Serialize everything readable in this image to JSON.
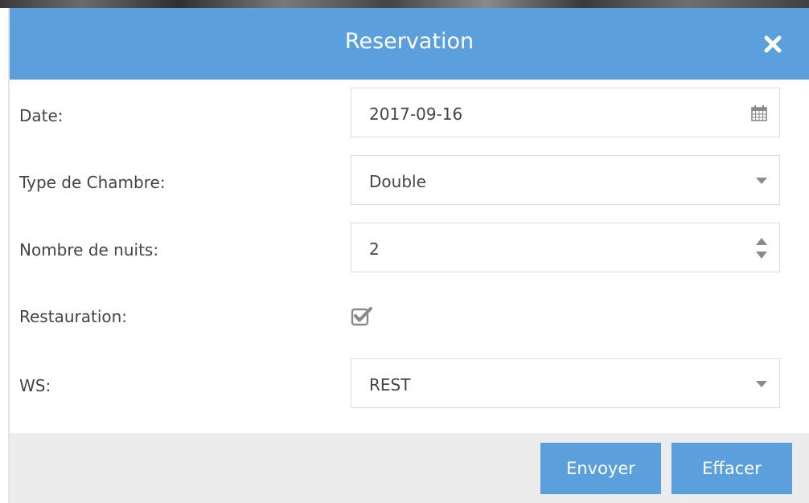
{
  "dialog": {
    "title": "Reservation"
  },
  "form": {
    "date": {
      "label": "Date:",
      "value": "2017-09-16"
    },
    "room_type": {
      "label": "Type de Chambre:",
      "value": "Double"
    },
    "nights": {
      "label": "Nombre de nuits:",
      "value": "2"
    },
    "catering": {
      "label": "Restauration:",
      "checked": true
    },
    "ws": {
      "label": "WS:",
      "value": "REST"
    }
  },
  "footer": {
    "submit_label": "Envoyer",
    "clear_label": "Effacer"
  },
  "colors": {
    "accent": "#5ba0dd",
    "footer_bg": "#ececec",
    "border": "#dcdcdc",
    "text": "#444444"
  },
  "icons": {
    "close": "close-icon",
    "date": "calendar-icon",
    "room_type": "chevron-down-icon",
    "nights": "spinner-icon",
    "catering": "checkbox-checked-icon",
    "ws": "chevron-down-icon"
  }
}
